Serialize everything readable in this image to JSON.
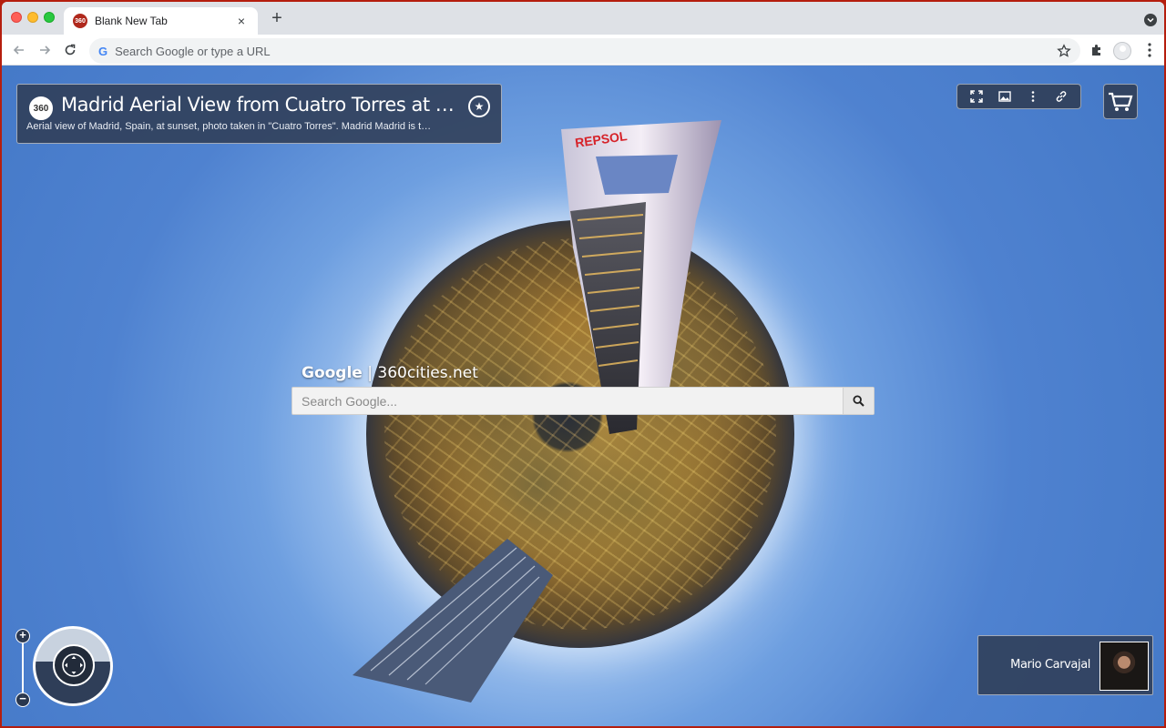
{
  "browser": {
    "tab_title": "Blank New Tab",
    "tab_favicon": "360",
    "tab_close": "×",
    "new_tab": "+",
    "omnibox_placeholder": "Search Google or type a URL"
  },
  "panorama": {
    "logo_label": "360",
    "title": "Madrid Aerial View from Cuatro Torres at sunset",
    "description": "Aerial view of Madrid, Spain, at sunset, photo taken in \"Cuatro Torres\". Madrid Madrid is the capital of Spain",
    "favorite_icon": "star-icon"
  },
  "tools": {
    "icons": [
      "fullscreen-icon",
      "image-icon",
      "more-icon",
      "link-icon"
    ],
    "cart_icon": "cart-icon"
  },
  "search": {
    "brand_google": "Google",
    "brand_separator": " | ",
    "brand_site": "360cities.net",
    "placeholder": "Search Google..."
  },
  "navigation": {
    "zoom_in": "+",
    "zoom_out": "−"
  },
  "author": {
    "name": "Mario Carvajal"
  },
  "colors": {
    "accent": "#303e56",
    "sky": "#4f82d0",
    "window_frame": "#b51e0e"
  }
}
